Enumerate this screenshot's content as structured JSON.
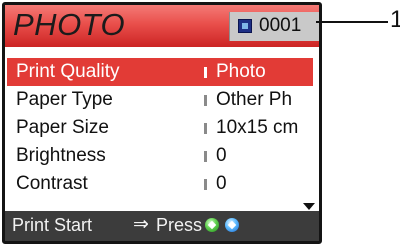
{
  "header": {
    "mode_title": "PHOTO",
    "counter_icon": "copies-icon",
    "counter_value": "0001"
  },
  "settings": [
    {
      "label": "Print Quality",
      "value": "Photo",
      "selected": true
    },
    {
      "label": "Paper Type",
      "value": "Other Ph",
      "selected": false
    },
    {
      "label": "Paper Size",
      "value": "10x15 cm",
      "selected": false
    },
    {
      "label": "Brightness",
      "value": "0",
      "selected": false
    },
    {
      "label": "Contrast",
      "value": "0",
      "selected": false
    }
  ],
  "footer": {
    "instruction": "Print Start",
    "arrow": "⇒",
    "press": "Press",
    "button_icons": [
      "green-start-button-icon",
      "blue-start-button-icon"
    ]
  },
  "callout": {
    "number": "1"
  },
  "colors": {
    "header_red": "#e94f4b",
    "selected_row": "#e23b36",
    "footer_bg": "#3c3c3c"
  }
}
